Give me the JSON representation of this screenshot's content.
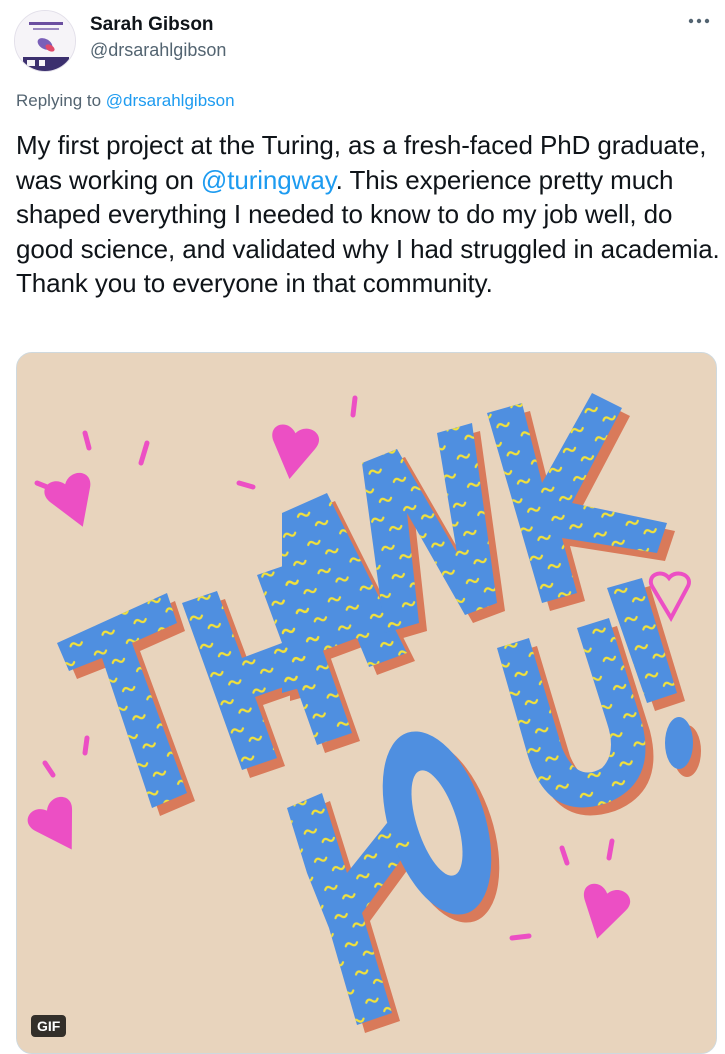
{
  "author": {
    "name": "Sarah Gibson",
    "handle": "@drsarahlgibson",
    "avatar_icon": "profile-photo"
  },
  "reply": {
    "prefix": "Replying to ",
    "mention": "@drsarahlgibson"
  },
  "tweet": {
    "text_before": "My first project at the Turing, as a fresh-faced PhD graduate, was working on ",
    "link": "@turingway",
    "text_after": ". This experience pretty much shaped everything I needed to know to do my job well, do good science, and validated why I had struggled in academia. Thank you to everyone in that community."
  },
  "media": {
    "badge": "GIF",
    "background_color": "#e8d4bd",
    "letter_color": "#4f8fe0",
    "shadow_color": "#d97a5a",
    "squiggle_color": "#f2e13a",
    "heart_color": "#ec4fc4"
  },
  "actions": {
    "more_icon": "more-icon"
  },
  "colors": {
    "link": "#1d9bf0",
    "secondary_text": "#536471"
  }
}
